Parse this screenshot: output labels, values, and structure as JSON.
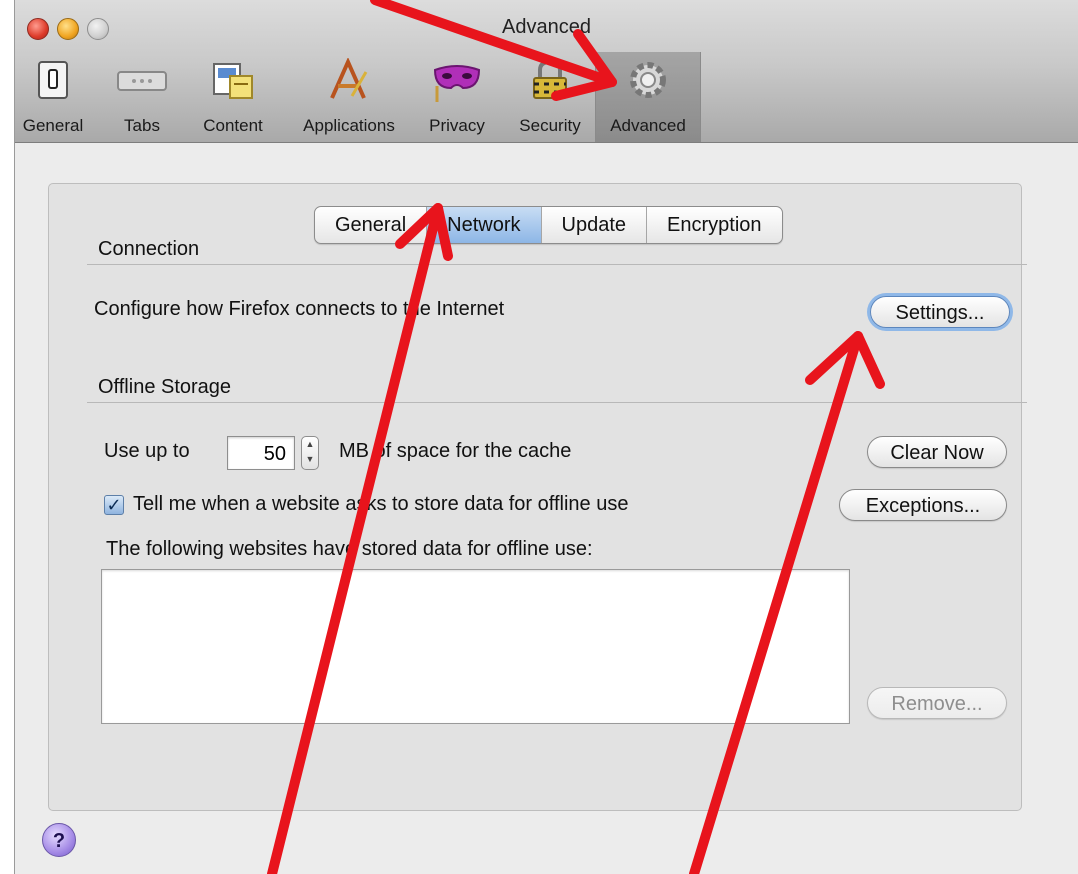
{
  "window": {
    "title": "Advanced"
  },
  "toolbar": {
    "items": [
      {
        "label": "General",
        "icon": "switch-icon"
      },
      {
        "label": "Tabs",
        "icon": "tabs-icon"
      },
      {
        "label": "Content",
        "icon": "content-icon"
      },
      {
        "label": "Applications",
        "icon": "applications-icon"
      },
      {
        "label": "Privacy",
        "icon": "mask-icon"
      },
      {
        "label": "Security",
        "icon": "padlock-icon"
      },
      {
        "label": "Advanced",
        "icon": "gear-icon"
      }
    ],
    "selected": "Advanced"
  },
  "tabs": {
    "items": [
      "General",
      "Network",
      "Update",
      "Encryption"
    ],
    "active": "Network"
  },
  "connection": {
    "heading": "Connection",
    "description": "Configure how Firefox connects to the Internet",
    "settings_button": "Settings..."
  },
  "offline": {
    "heading": "Offline Storage",
    "use_up_to": "Use up to",
    "cache_value": "50",
    "cache_suffix": "MB of space for the cache",
    "clear_now_button": "Clear Now",
    "tell_me_label": "Tell me when a website asks to store data for offline use",
    "tell_me_checked": true,
    "exceptions_button": "Exceptions...",
    "stored_label": "The following websites have stored data for offline use:",
    "remove_button": "Remove..."
  },
  "help": {
    "label": "?"
  },
  "colors": {
    "arrow": "#e8141c",
    "active_tab": "#8db6e6"
  }
}
